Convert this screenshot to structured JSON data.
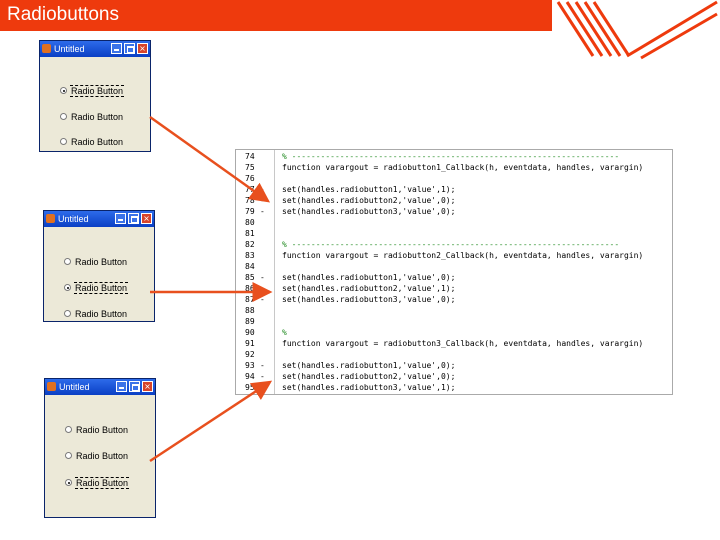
{
  "header": {
    "title": "Radiobuttons"
  },
  "windows": [
    {
      "title": "Untitled",
      "radios": [
        {
          "label": "Radio Button",
          "checked": true,
          "focused": true
        },
        {
          "label": "Radio Button",
          "checked": false,
          "focused": false
        },
        {
          "label": "Radio Button",
          "checked": false,
          "focused": false
        }
      ]
    },
    {
      "title": "Untitled",
      "radios": [
        {
          "label": "Radio Button",
          "checked": false,
          "focused": false
        },
        {
          "label": "Radio Button",
          "checked": true,
          "focused": true
        },
        {
          "label": "Radio Button",
          "checked": false,
          "focused": false
        }
      ]
    },
    {
      "title": "Untitled",
      "radios": [
        {
          "label": "Radio Button",
          "checked": false,
          "focused": false
        },
        {
          "label": "Radio Button",
          "checked": false,
          "focused": false
        },
        {
          "label": "Radio Button",
          "checked": true,
          "focused": true
        }
      ]
    }
  ],
  "code": {
    "lines": [
      {
        "num": "74",
        "marker": "",
        "text": "% --------------------------------------------------------------------",
        "comment": true
      },
      {
        "num": "75",
        "marker": "",
        "text": "function varargout = radiobutton1_Callback(h, eventdata, handles, varargin)",
        "comment": false
      },
      {
        "num": "76",
        "marker": "",
        "text": "",
        "comment": false
      },
      {
        "num": "77",
        "marker": "-",
        "text": "set(handles.radiobutton1,'value',1);",
        "comment": false
      },
      {
        "num": "78",
        "marker": "-",
        "text": "set(handles.radiobutton2,'value',0);",
        "comment": false
      },
      {
        "num": "79",
        "marker": "-",
        "text": "set(handles.radiobutton3,'value',0);",
        "comment": false
      },
      {
        "num": "80",
        "marker": "",
        "text": "",
        "comment": false
      },
      {
        "num": "81",
        "marker": "",
        "text": "",
        "comment": false
      },
      {
        "num": "82",
        "marker": "",
        "text": "% --------------------------------------------------------------------",
        "comment": true
      },
      {
        "num": "83",
        "marker": "",
        "text": "function varargout = radiobutton2_Callback(h, eventdata, handles, varargin)",
        "comment": false
      },
      {
        "num": "84",
        "marker": "",
        "text": "",
        "comment": false
      },
      {
        "num": "85",
        "marker": "-",
        "text": "set(handles.radiobutton1,'value',0);",
        "comment": false
      },
      {
        "num": "86",
        "marker": "-",
        "text": "set(handles.radiobutton2,'value',1);",
        "comment": false
      },
      {
        "num": "87",
        "marker": "-",
        "text": "set(handles.radiobutton3,'value',0);",
        "comment": false
      },
      {
        "num": "88",
        "marker": "",
        "text": "",
        "comment": false
      },
      {
        "num": "89",
        "marker": "",
        "text": "",
        "comment": false
      },
      {
        "num": "90",
        "marker": "",
        "text": "%",
        "comment": true
      },
      {
        "num": "91",
        "marker": "",
        "text": "function varargout = radiobutton3_Callback(h, eventdata, handles, varargin)",
        "comment": false
      },
      {
        "num": "92",
        "marker": "",
        "text": "",
        "comment": false
      },
      {
        "num": "93",
        "marker": "-",
        "text": "set(handles.radiobutton1,'value',0);",
        "comment": false
      },
      {
        "num": "94",
        "marker": "-",
        "text": "set(handles.radiobutton2,'value',0);",
        "comment": false
      },
      {
        "num": "95",
        "marker": "-",
        "text": "set(handles.radiobutton3,'value',1);",
        "comment": false
      }
    ]
  },
  "colors": {
    "accent": "#ee3a0d",
    "arrow": "#e8501e",
    "comment": "#228b22"
  }
}
